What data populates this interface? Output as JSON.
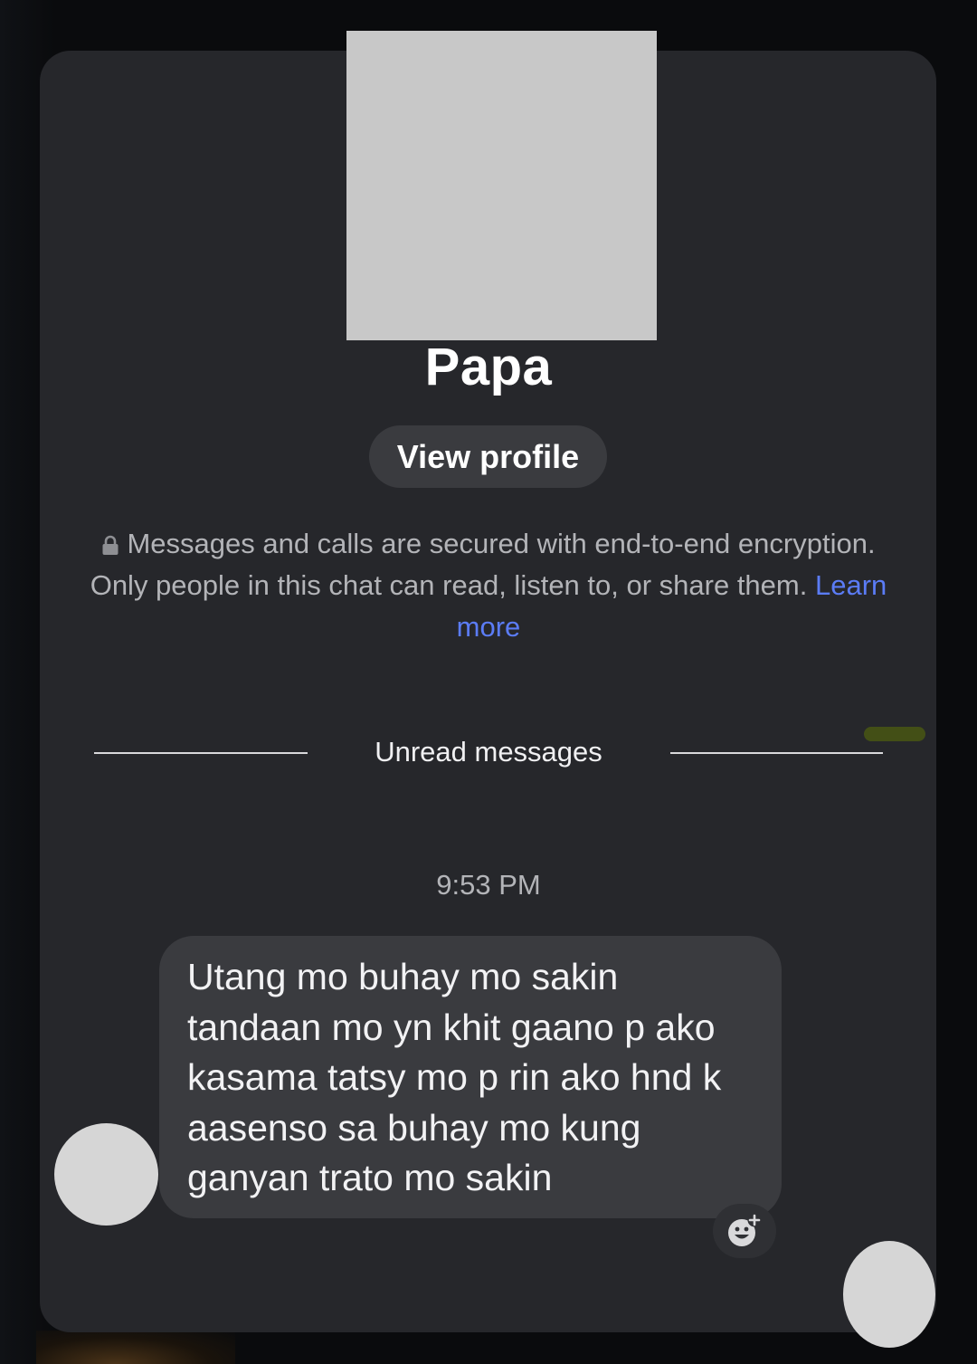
{
  "chat": {
    "contact_name": "Papa",
    "view_profile_label": "View profile",
    "encryption_notice": "Messages and calls are secured with end-to-end encryption. Only people in this chat can read, listen to, or share them.",
    "learn_more_label": "Learn more",
    "unread_divider_label": "Unread messages"
  },
  "messages": [
    {
      "time": "9:53 PM",
      "text": "Utang mo buhay mo sakin\ntandaan mo yn khit gaano p ako\nkasama tatsy mo p rin ako hnd k\naasenso sa buhay mo kung\nganyan trato mo sakin",
      "direction": "incoming"
    }
  ],
  "icons": {
    "lock": "lock-icon",
    "reaction": "add-reaction-icon"
  },
  "colors": {
    "background": "#0a0b0d",
    "panel": "#26272b",
    "bubble": "#3a3b3f",
    "link": "#5b7cf6",
    "text_primary": "#ffffff",
    "text_secondary": "#b3b4b8"
  }
}
